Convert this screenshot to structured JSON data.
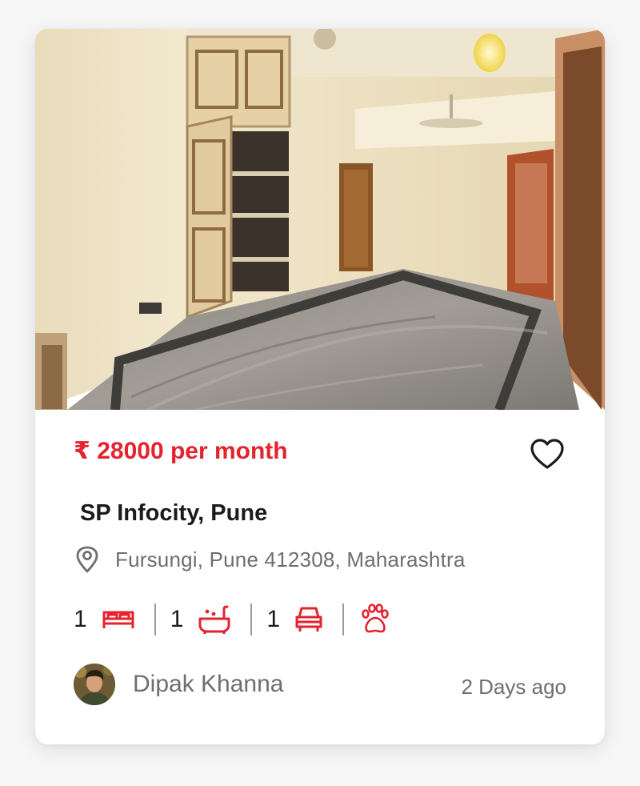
{
  "listing": {
    "price": "₹ 28000 per month",
    "title": "SP Infocity, Pune",
    "address": "Fursungi, Pune 412308, Maharashtra",
    "posted": "2 Days ago",
    "favorited": false
  },
  "amenities": [
    {
      "count": "1",
      "icon": "bed-icon"
    },
    {
      "count": "1",
      "icon": "bathtub-icon"
    },
    {
      "count": "1",
      "icon": "car-icon"
    },
    {
      "count": "",
      "icon": "paw-icon"
    }
  ],
  "owner": {
    "name": "Dipak Khanna",
    "avatar_icon": "owner-avatar"
  },
  "colors": {
    "accent": "#e4232f",
    "text_dark": "#1b1b1b",
    "text_muted": "#6e6e6e",
    "background": "#f6f6f7"
  }
}
